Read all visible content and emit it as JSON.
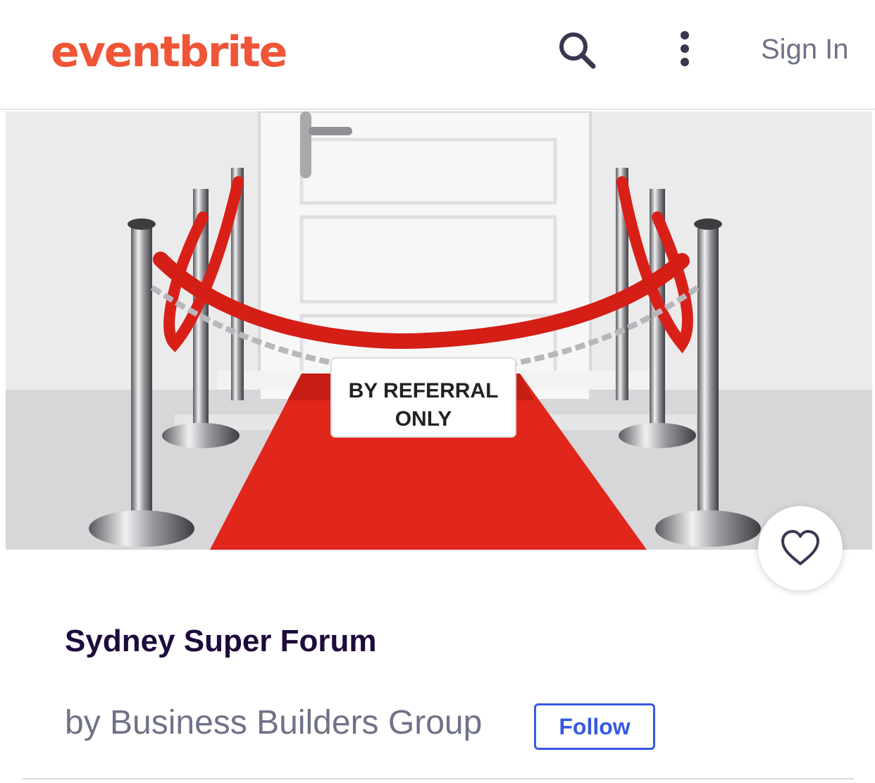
{
  "header": {
    "logo": "eventbrite",
    "search_icon": "search-icon",
    "menu_icon": "more-vertical-icon",
    "sign_in": "Sign In"
  },
  "hero": {
    "sign_line1": "BY REFERRAL",
    "sign_line2": "ONLY"
  },
  "event": {
    "title": "Sydney Super Forum",
    "organizer": "by Business Builders Group",
    "follow_label": "Follow",
    "favorite_icon": "heart-icon"
  },
  "colors": {
    "brand": "#f05537",
    "title": "#1e0a3c",
    "muted": "#6f7287",
    "link": "#3659e3"
  }
}
